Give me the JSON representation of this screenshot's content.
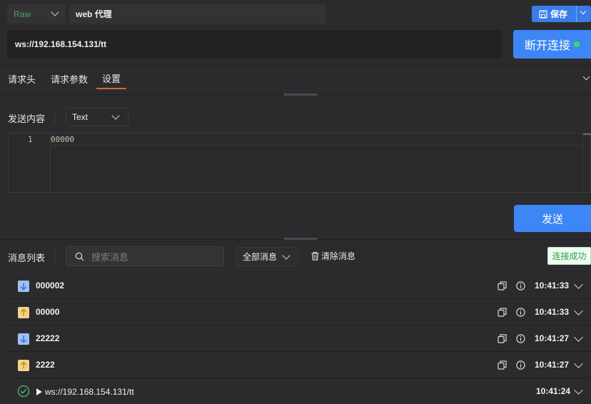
{
  "toolbar": {
    "mode_select": "Raw",
    "request_name": "web 代理",
    "save_label": "保存"
  },
  "url_bar": {
    "url": "ws://192.168.154.131/tt",
    "connect_label": "断开连接"
  },
  "tabs": [
    {
      "label": "请求头",
      "active": false
    },
    {
      "label": "请求参数",
      "active": false
    },
    {
      "label": "设置",
      "active": true
    }
  ],
  "send": {
    "label": "发送内容",
    "type": "Text",
    "line_number": "1",
    "content": "00000",
    "send_label": "发送"
  },
  "messages": {
    "label": "消息列表",
    "search_placeholder": "搜索消息",
    "filter": "全部消息",
    "clear_label": "清除消息",
    "status": "连接成功",
    "items": [
      {
        "direction": "received",
        "text": "000002",
        "time": "10:41:33"
      },
      {
        "direction": "sent",
        "text": "00000",
        "time": "10:41:33"
      },
      {
        "direction": "received",
        "text": "22222",
        "time": "10:41:27"
      },
      {
        "direction": "sent",
        "text": "2222",
        "time": "10:41:27"
      },
      {
        "direction": "connected",
        "text": "ws://192.168.154.131/tt",
        "time": "10:41:24"
      }
    ]
  },
  "colors": {
    "accent": "#3d86f5",
    "active_tab": "#e0662a",
    "success": "#2aa14a",
    "received_icon": "#9dbff3",
    "sent_icon": "#f3d18a"
  }
}
